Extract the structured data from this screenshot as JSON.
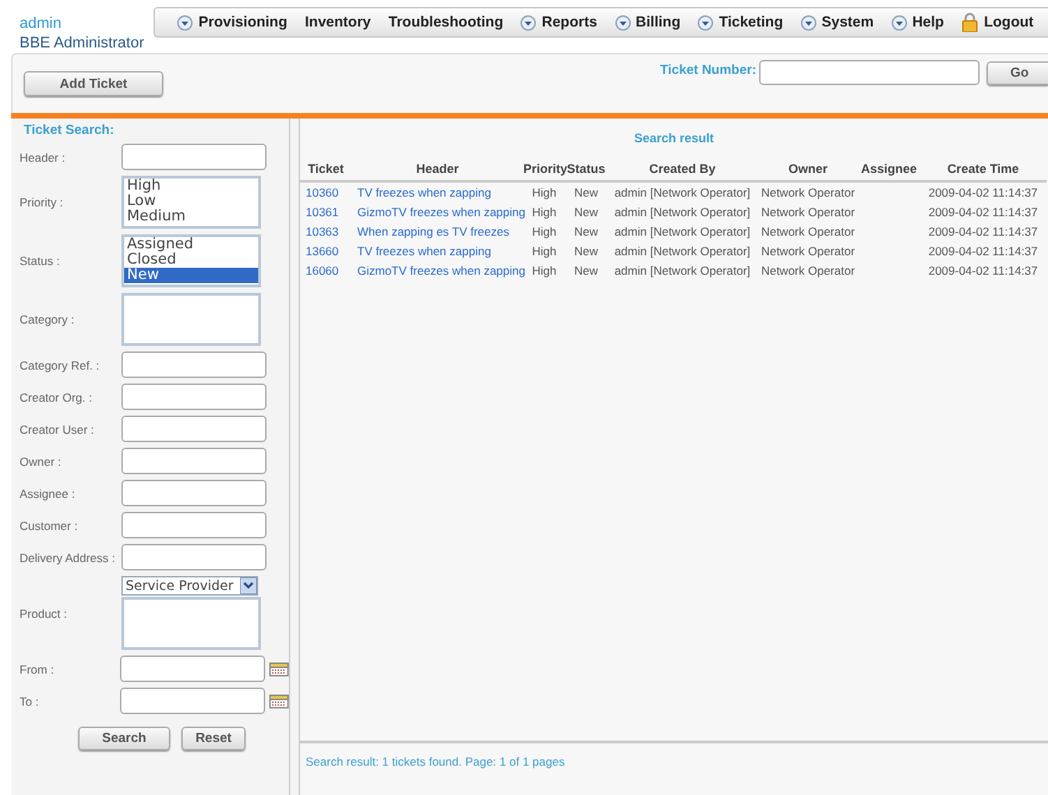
{
  "user": {
    "name": "admin",
    "role": "BBE Administrator"
  },
  "nav": [
    {
      "label": "Provisioning",
      "has_menu": true
    },
    {
      "label": "Inventory",
      "has_menu": false
    },
    {
      "label": "Troubleshooting",
      "has_menu": false
    },
    {
      "label": "Reports",
      "has_menu": true
    },
    {
      "label": "Billing",
      "has_menu": true
    },
    {
      "label": "Ticketing",
      "has_menu": true
    },
    {
      "label": "System",
      "has_menu": true
    },
    {
      "label": "Help",
      "has_menu": true
    },
    {
      "label": "Logout",
      "has_menu": false,
      "kind": "logout"
    }
  ],
  "toolbar": {
    "add_button": "Add Ticket",
    "ticket_number_label": "Ticket Number:",
    "go_button": "Go"
  },
  "search": {
    "title": "Ticket Search:",
    "fields": [
      {
        "label": "Header :",
        "kind": "text"
      },
      {
        "label": "Priority :",
        "kind": "list",
        "options": [
          {
            "label": "High",
            "selected": false
          },
          {
            "label": "Low",
            "selected": false
          },
          {
            "label": "Medium",
            "selected": false
          }
        ]
      },
      {
        "label": "Status :",
        "kind": "list",
        "options": [
          {
            "label": "Assigned",
            "selected": false
          },
          {
            "label": "Closed",
            "selected": false
          },
          {
            "label": "New",
            "selected": true
          }
        ]
      },
      {
        "label": "Category :",
        "kind": "list"
      },
      {
        "label": "Category Ref. :",
        "kind": "text"
      },
      {
        "label": "Creator Org. :",
        "kind": "text"
      },
      {
        "label": "Creator User :",
        "kind": "text"
      },
      {
        "label": "Owner :",
        "kind": "text"
      },
      {
        "label": "Assignee :",
        "kind": "text"
      },
      {
        "label": "Customer :",
        "kind": "text"
      },
      {
        "label": "Delivery Address :",
        "kind": "text"
      },
      {
        "label": "Product :",
        "kind": "product",
        "dropdown": "Service Provider"
      },
      {
        "label": "From :",
        "kind": "date"
      },
      {
        "label": "To :",
        "kind": "date"
      }
    ],
    "buttons": [
      "Search",
      "Reset"
    ]
  },
  "results": {
    "title": "Search result",
    "columns": [
      "Ticket",
      "Header",
      "Priority",
      "Status",
      "Created By",
      "Owner",
      "Assignee",
      "Create Time"
    ],
    "rows": [
      [
        "10360",
        "TV freezes when zapping",
        "High",
        "New",
        "admin [Network Operator]",
        "Network Operator",
        "",
        "2009-04-02 11:14:37"
      ],
      [
        "10361",
        "GizmoTV freezes when zapping",
        "High",
        "New",
        "admin [Network Operator]",
        "Network Operator",
        "",
        "2009-04-02 11:14:37"
      ],
      [
        "10363",
        "When zapping es TV freezes",
        "High",
        "New",
        "admin [Network Operator]",
        "Network Operator",
        "",
        "2009-04-02 11:14:37"
      ],
      [
        "13660",
        "TV freezes when zapping",
        "High",
        "New",
        "admin [Network Operator]",
        "Network Operator",
        "",
        "2009-04-02 11:14:37"
      ],
      [
        "16060",
        "GizmoTV freezes when zapping",
        "High",
        "New",
        "admin [Network Operator]",
        "Network Operator",
        "",
        "2009-04-02 11:14:37"
      ]
    ],
    "summary": "Search result: 1 tickets found. Page: 1 of  1 pages"
  }
}
